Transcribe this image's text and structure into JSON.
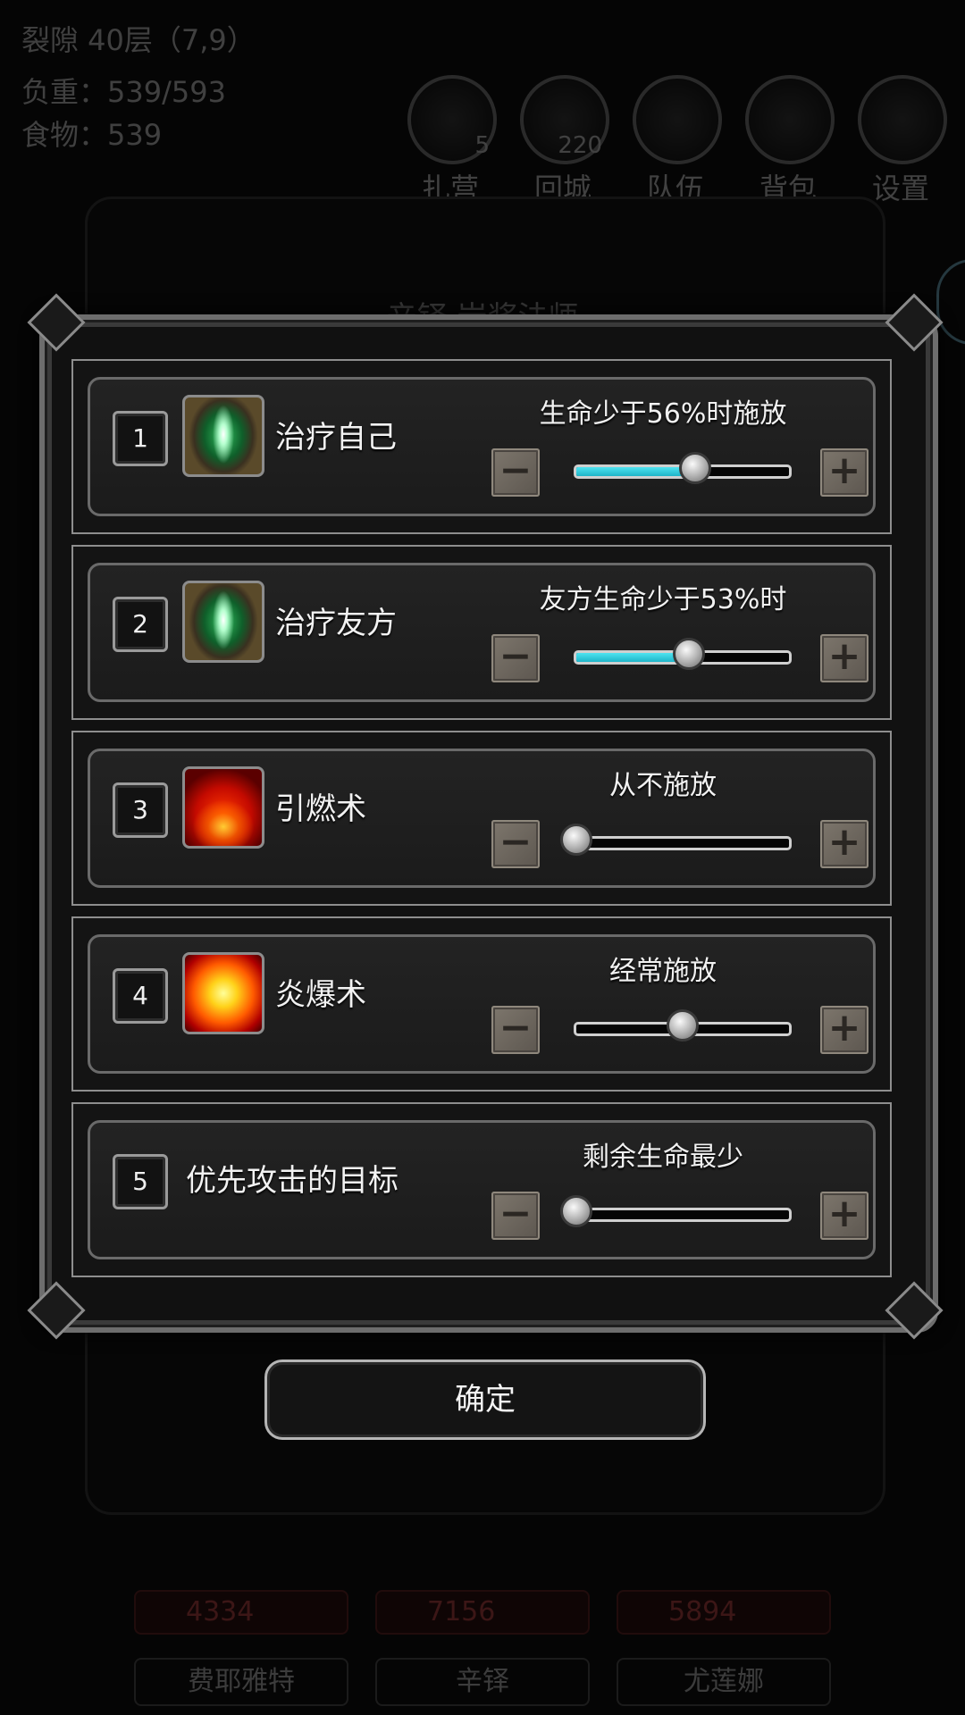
{
  "hud": {
    "location": "裂隙 40层（7,9）",
    "weight": "负重：539/593",
    "food": "食物：539",
    "buttons": [
      {
        "icon": "camp-icon",
        "label": "扎营",
        "count": "5"
      },
      {
        "icon": "town-portal-icon",
        "label": "回城",
        "count": "220"
      },
      {
        "icon": "team-icon",
        "label": "队伍",
        "count": ""
      },
      {
        "icon": "backpack-icon",
        "label": "背包",
        "count": ""
      },
      {
        "icon": "gear-icon",
        "label": "设置",
        "count": ""
      }
    ],
    "panel_title": "辛铎 岩浆法师",
    "party": [
      {
        "hp": "4334",
        "name": "费耶雅特"
      },
      {
        "hp": "7156",
        "name": "辛铎"
      },
      {
        "hp": "5894",
        "name": "尤莲娜"
      }
    ]
  },
  "skills": [
    {
      "index": "1",
      "name": "治疗自己",
      "icon": "heal-icon",
      "condition": "生命少于56%时施放",
      "value": 56,
      "fill_color": "#35d0e0"
    },
    {
      "index": "2",
      "name": "治疗友方",
      "icon": "heal-icon",
      "condition": "友方生命少于53%时",
      "value": 53,
      "fill_color": "#35d0e0"
    },
    {
      "index": "3",
      "name": "引燃术",
      "icon": "fire-icon",
      "condition": "从不施放",
      "value": 0,
      "fill_color": ""
    },
    {
      "index": "4",
      "name": "炎爆术",
      "icon": "explosion-icon",
      "condition": "经常施放",
      "value": 50,
      "fill_color": ""
    },
    {
      "index": "5",
      "name": "优先攻击的目标",
      "icon": "",
      "condition": "剩余生命最少",
      "value": 0,
      "fill_color": ""
    }
  ],
  "stepper": {
    "minus": "−",
    "plus": "+"
  },
  "confirm_label": "确定"
}
